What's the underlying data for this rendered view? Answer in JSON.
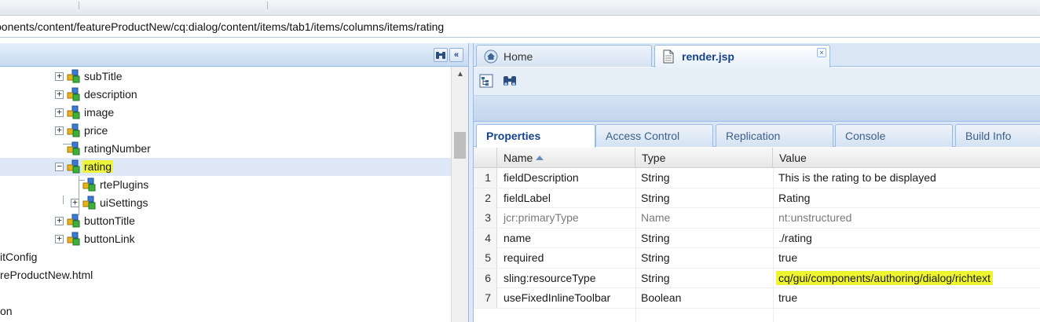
{
  "path": {
    "value": "ponents/content/featureProductNew/cq:dialog/content/items/tab1/items/columns/items/rating"
  },
  "tree": {
    "nodes": [
      {
        "label": "subTitle",
        "expander": "+"
      },
      {
        "label": "description",
        "expander": "+"
      },
      {
        "label": "image",
        "expander": "+"
      },
      {
        "label": "price",
        "expander": "+"
      },
      {
        "label": "ratingNumber",
        "expander": ""
      },
      {
        "label": "rating",
        "expander": "−"
      },
      {
        "label": "rtePlugins",
        "expander": ""
      },
      {
        "label": "uiSettings",
        "expander": "+"
      },
      {
        "label": "buttonTitle",
        "expander": "+"
      },
      {
        "label": "buttonLink",
        "expander": "+"
      },
      {
        "label": "itConfig",
        "expander": ""
      },
      {
        "label": "reProductNew.html",
        "expander": ""
      },
      {
        "label": "on",
        "expander": ""
      }
    ],
    "selected": "rating",
    "collapse_label": "«"
  },
  "editor_tabs": [
    {
      "label": "Home",
      "icon": "home-icon"
    },
    {
      "label": "render.jsp",
      "icon": "file-icon",
      "close": "×"
    }
  ],
  "properties_tabs": [
    "Properties",
    "Access Control",
    "Replication",
    "Console",
    "Build Info"
  ],
  "grid": {
    "columns": [
      "Name",
      "Type",
      "Value"
    ],
    "rows": [
      {
        "num": "1",
        "name": "fieldDescription",
        "type": "String",
        "value": "This is the rating to be displayed"
      },
      {
        "num": "2",
        "name": "fieldLabel",
        "type": "String",
        "value": "Rating"
      },
      {
        "num": "3",
        "name": "jcr:primaryType",
        "type": "Name",
        "value": "nt:unstructured"
      },
      {
        "num": "4",
        "name": "name",
        "type": "String",
        "value": "./rating"
      },
      {
        "num": "5",
        "name": "required",
        "type": "String",
        "value": "true"
      },
      {
        "num": "6",
        "name": "sling:resourceType",
        "type": "String",
        "value": "cq/gui/components/authoring/dialog/richtext"
      },
      {
        "num": "7",
        "name": "useFixedInlineToolbar",
        "type": "Boolean",
        "value": "true"
      }
    ]
  },
  "colors": {
    "accent": "#15428b",
    "highlight": "#ecf53a",
    "panel_header": "#c6daf0",
    "selection": "#dfe8f6"
  }
}
